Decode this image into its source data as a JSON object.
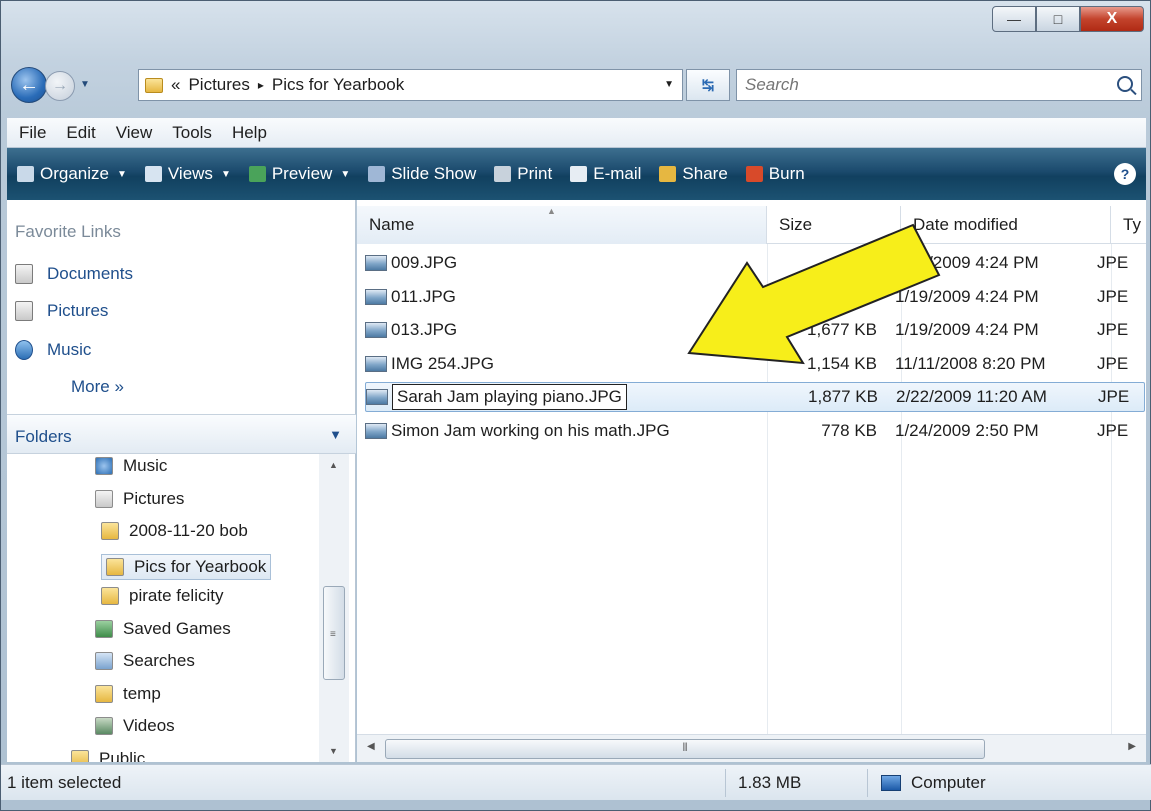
{
  "window": {
    "minimize_label": "—",
    "maximize_label": "□",
    "close_label": "X"
  },
  "nav": {
    "back_icon": "back-arrow-icon",
    "forward_icon": "forward-arrow-icon",
    "address_prefix": "«",
    "breadcrumb": [
      "Pictures",
      "Pics for Yearbook"
    ],
    "breadcrumb_sep": "▸",
    "search_placeholder": "Search"
  },
  "menu": [
    "File",
    "Edit",
    "View",
    "Tools",
    "Help"
  ],
  "toolbar": [
    {
      "label": "Organize",
      "dropdown": true,
      "color": "#c9d9e9"
    },
    {
      "label": "Views",
      "dropdown": true,
      "color": "#d7e4f1"
    },
    {
      "label": "Preview",
      "dropdown": true,
      "color": "#4aa35a"
    },
    {
      "label": "Slide Show",
      "dropdown": false,
      "color": "#9fb7d6"
    },
    {
      "label": "Print",
      "dropdown": false,
      "color": "#c8d2dc"
    },
    {
      "label": "E-mail",
      "dropdown": false,
      "color": "#e7edf3"
    },
    {
      "label": "Share",
      "dropdown": false,
      "color": "#e6b741"
    },
    {
      "label": "Burn",
      "dropdown": false,
      "color": "#d84a2a"
    }
  ],
  "help_label": "?",
  "favorites": {
    "header": "Favorite Links",
    "items": [
      "Documents",
      "Pictures",
      "Music"
    ],
    "more": "More »"
  },
  "folders": {
    "header": "Folders",
    "items": [
      {
        "label": "Music",
        "indent": 1,
        "kind": "music"
      },
      {
        "label": "Pictures",
        "indent": 1,
        "kind": "pictures"
      },
      {
        "label": "2008-11-20 bob",
        "indent": 2,
        "kind": "folder"
      },
      {
        "label": "Pics for Yearbook",
        "indent": 2,
        "kind": "folder",
        "selected": true
      },
      {
        "label": "pirate felicity",
        "indent": 2,
        "kind": "folder"
      },
      {
        "label": "Saved Games",
        "indent": 1,
        "kind": "games"
      },
      {
        "label": "Searches",
        "indent": 1,
        "kind": "search"
      },
      {
        "label": "temp",
        "indent": 1,
        "kind": "folder"
      },
      {
        "label": "Videos",
        "indent": 1,
        "kind": "videos"
      },
      {
        "label": "Public",
        "indent": 0,
        "kind": "folder"
      }
    ]
  },
  "columns": {
    "name": "Name",
    "size": "Size",
    "date": "Date modified",
    "type": "Ty"
  },
  "files": [
    {
      "name": "009.JPG",
      "size": "",
      "date": "1/19/2009 4:24 PM",
      "type": "JPE"
    },
    {
      "name": "011.JPG",
      "size": "",
      "date": "1/19/2009 4:24 PM",
      "type": "JPE"
    },
    {
      "name": "013.JPG",
      "size": "1,677 KB",
      "date": "1/19/2009 4:24 PM",
      "type": "JPE"
    },
    {
      "name": "IMG 254.JPG",
      "size": "1,154 KB",
      "date": "11/11/2008 8:20 PM",
      "type": "JPE"
    },
    {
      "name": "Sarah Jam playing piano.JPG",
      "size": "1,877 KB",
      "date": "2/22/2009 11:20 AM",
      "type": "JPE",
      "selected": true
    },
    {
      "name": "Simon Jam working on his math.JPG",
      "size": "778 KB",
      "date": "1/24/2009 2:50 PM",
      "type": "JPE"
    }
  ],
  "status": {
    "selection": "1 item selected",
    "size": "1.83 MB",
    "location": "Computer"
  },
  "annotation_arrow_color": "#f7ee1a"
}
